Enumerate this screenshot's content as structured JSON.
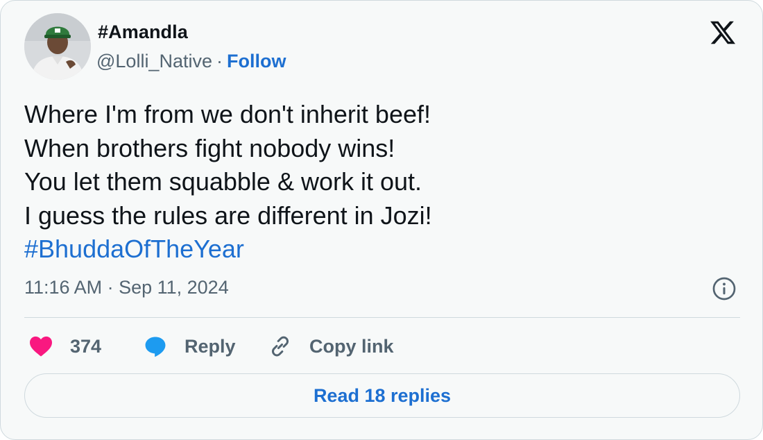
{
  "author": {
    "display_name": "#Amandla",
    "handle": "@Lolli_Native",
    "separator": "·",
    "follow_label": "Follow",
    "avatar_icon": "profile-photo"
  },
  "tweet": {
    "lines": [
      "Where I'm from we don't inherit beef!",
      "When brothers fight nobody wins!",
      "You let them squabble & work it out.",
      "I guess the rules are different in Jozi!"
    ],
    "hashtag": "#BhuddaOfTheYear",
    "timestamp": "11:16 AM · Sep 11, 2024"
  },
  "actions": {
    "like_count": "374",
    "reply_label": "Reply",
    "copy_link_label": "Copy link"
  },
  "footer": {
    "read_replies_label": "Read 18 replies"
  },
  "colors": {
    "accent": "#1d6fd1",
    "like": "#f91880",
    "reply_bubble": "#1d9bf0",
    "muted": "#536471",
    "border": "#cfd9de",
    "background": "#f7f9f9"
  },
  "icons": [
    "x-logo-icon",
    "info-icon",
    "heart-icon",
    "reply-bubble-icon",
    "link-icon"
  ]
}
